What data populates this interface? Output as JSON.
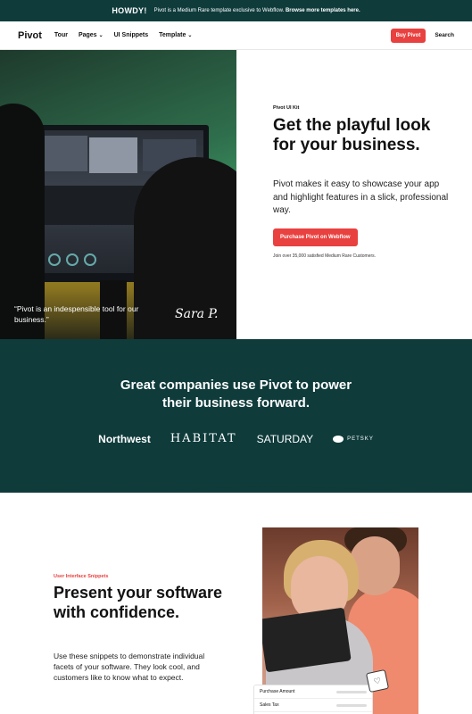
{
  "announcement": {
    "badge": "HOWDY!",
    "message": "Pivot is a Medium Rare template exclusive to Webflow.",
    "link": "Browse more templates here."
  },
  "nav": {
    "logo": "Pivot",
    "links": [
      "Tour",
      "Pages",
      "UI Snippets",
      "Template"
    ],
    "buy_label": "Buy Pivot",
    "search_label": "Search"
  },
  "hero": {
    "quote": "“Pivot is an indespensible tool for our business.”",
    "signature": "Sara P.",
    "eyebrow": "Pivot UI Kit",
    "title": "Get the playful look for your business.",
    "text": "Pivot makes it easy to showcase your app and highlight features in a slick, professional way.",
    "cta_label": "Purchase Pivot on Webflow",
    "small_text": "Join over 35,000 satisfied Medium Rare Customers."
  },
  "companies": {
    "title_line1": "Great companies use Pivot to power",
    "title_line2": "their business forward.",
    "logos": [
      "Northwest",
      "HABITAT",
      "SATURDAY",
      "PETSKY"
    ]
  },
  "snippets": {
    "eyebrow": "User Interface Snippets",
    "title": "Present your software with confidence.",
    "text": "Use these snippets to demonstrate individual facets of your software. They look cool, and customers like to know what to expect.",
    "card_rows": [
      "Purchase Amount",
      "Sales Tax"
    ]
  },
  "colors": {
    "brand_dark": "#0f3b3b",
    "accent_red": "#e8413f"
  },
  "icons": {
    "nav_chevron": "chevron-down-icon",
    "petsky_logo": "petsky-logo-icon",
    "bag": "shopping-bag-heart-icon"
  }
}
